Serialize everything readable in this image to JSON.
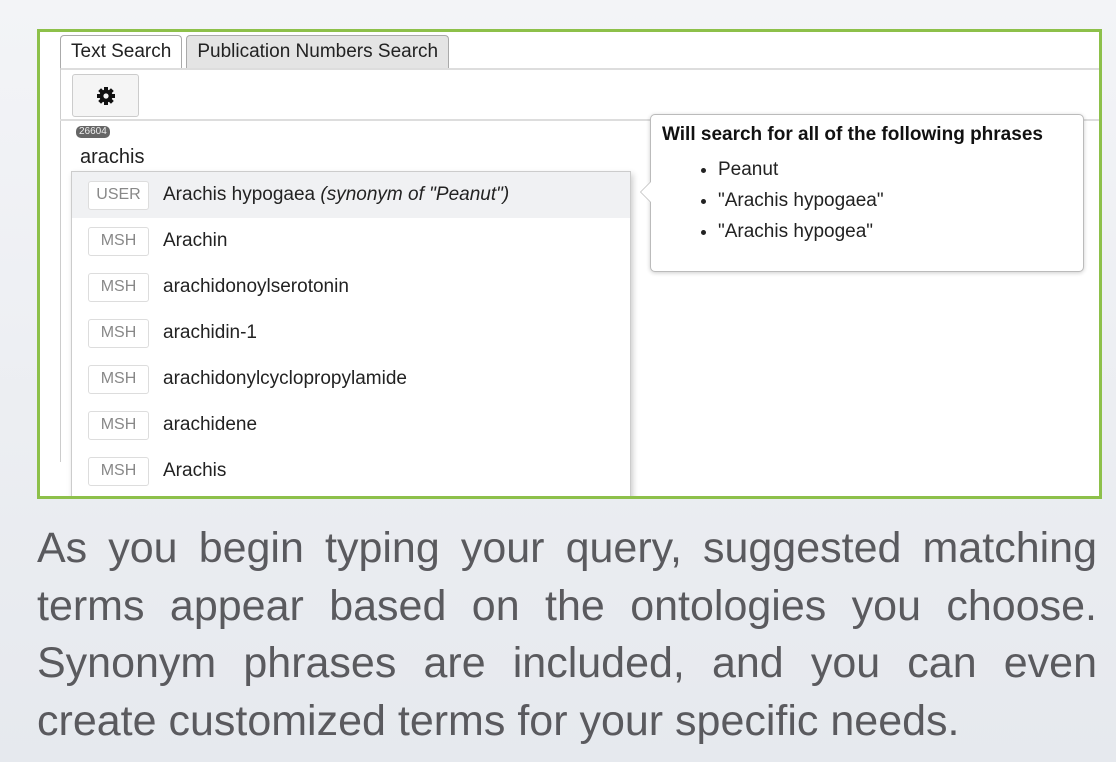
{
  "tabs": [
    {
      "label": "Text Search",
      "active": true
    },
    {
      "label": "Publication Numbers Search",
      "active": false
    }
  ],
  "toolbar": {
    "settings_icon": "gear-icon"
  },
  "search": {
    "badge": "26604",
    "query": "arachis"
  },
  "suggestions": [
    {
      "source": "USER",
      "term": "Arachis hypogaea",
      "note": "(synonym of \"Peanut\")"
    },
    {
      "source": "MSH",
      "term": "Arachin"
    },
    {
      "source": "MSH",
      "term": "arachidonoylserotonin"
    },
    {
      "source": "MSH",
      "term": "arachidin-1"
    },
    {
      "source": "MSH",
      "term": "arachidonylcyclopropylamide"
    },
    {
      "source": "MSH",
      "term": "arachidene"
    },
    {
      "source": "MSH",
      "term": "Arachis"
    }
  ],
  "popover": {
    "title": "Will search for all of the following phrases",
    "phrases": [
      "Peanut",
      "\"Arachis hypogaea\"",
      "\"Arachis hypogea\""
    ]
  },
  "caption": "As you begin typing your query, suggested matching terms appear based on the ontologies you choose. Synonym phrases are included, and you can even create customized terms for your specific needs.",
  "colors": {
    "frame": "#8dc04a",
    "caption": "#5a5a5e"
  }
}
